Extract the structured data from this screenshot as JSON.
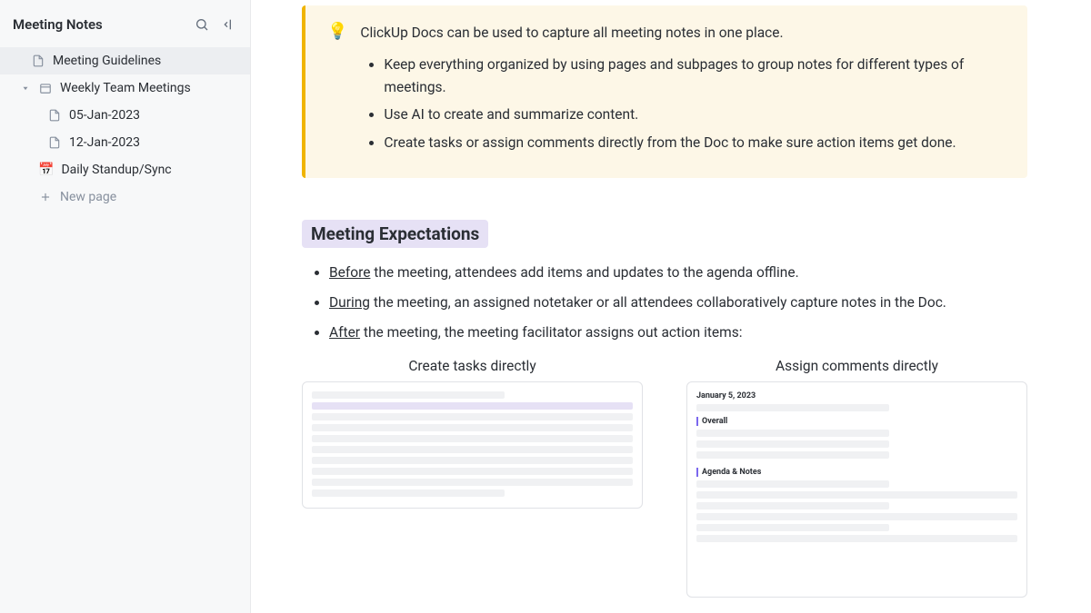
{
  "sidebar": {
    "title": "Meeting Notes",
    "items": [
      {
        "label": "Meeting Guidelines"
      },
      {
        "label": "Weekly Team Meetings"
      },
      {
        "label": "05-Jan-2023"
      },
      {
        "label": "12-Jan-2023"
      },
      {
        "label": "Daily Standup/Sync",
        "emoji": "📅"
      }
    ],
    "new_page": "New page"
  },
  "callout": {
    "intro": "ClickUp Docs can be used to capture all meeting notes in one place.",
    "bullets": [
      "Keep everything organized by using pages and subpages to group notes for different types of meetings.",
      "Use AI to create and summarize content.",
      "Create tasks or assign comments directly from the Doc to make sure action items get done."
    ]
  },
  "expectations": {
    "heading": "Meeting Expectations",
    "items": [
      {
        "u": "Before",
        "rest": " the meeting, attendees add items and updates to the agenda offline."
      },
      {
        "u": "During",
        "rest": " the meeting, an assigned notetaker or all attendees collaboratively capture notes in the Doc."
      },
      {
        "u": "After",
        "rest": " the meeting, the meeting facilitator assigns out action items:"
      }
    ]
  },
  "thumbs": {
    "left_title": "Create tasks directly",
    "right_title": "Assign comments directly",
    "right_date": "January 5, 2023",
    "right_overall": "Overall",
    "right_agenda": "Agenda & Notes"
  }
}
